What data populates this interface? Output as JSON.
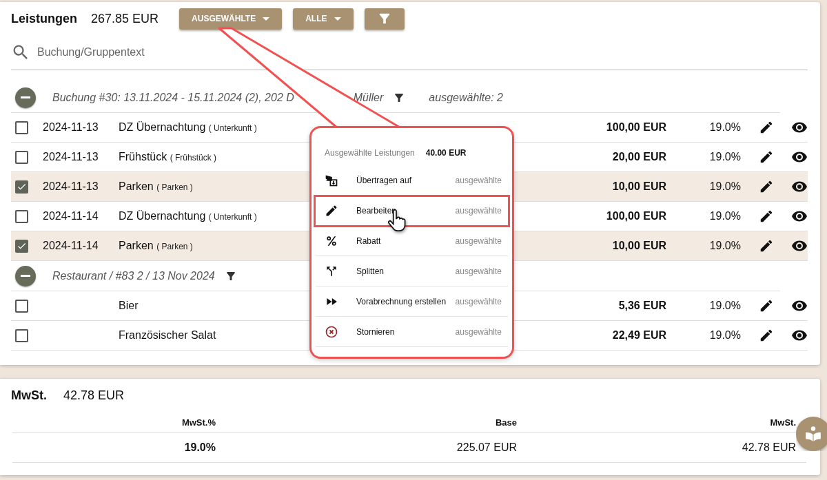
{
  "header": {
    "title": "Leistungen",
    "total": "267.85 EUR",
    "buttons": [
      {
        "kind": "dropdown",
        "label": "AUSGEWÄHLTE"
      },
      {
        "kind": "dropdown",
        "label": "ALLE"
      },
      {
        "kind": "filter"
      }
    ]
  },
  "search": {
    "placeholder": "Buchung/Gruppentext"
  },
  "groups": [
    {
      "expanded": true,
      "title_parts": [
        "Buchung #30: 13.11.2024 - 15.11.2024 (2), 202 D",
        "Müller"
      ],
      "selected_count": "ausgewählte: 2",
      "rows": [
        {
          "checked": false,
          "date": "2024-11-13",
          "name": "DZ Übernachtung",
          "category": "( Unterkunft )",
          "amount": "100,00 EUR",
          "vat": "19.0%"
        },
        {
          "checked": false,
          "date": "2024-11-13",
          "name": "Frühstück",
          "category": "( Frühstück )",
          "amount": "20,00 EUR",
          "vat": "19.0%"
        },
        {
          "checked": true,
          "date": "2024-11-13",
          "name": "Parken",
          "category": "( Parken )",
          "amount": "10,00 EUR",
          "vat": "19.0%"
        },
        {
          "checked": false,
          "date": "2024-11-14",
          "name": "DZ Übernachtung",
          "category": "( Unterkunft )",
          "amount": "100,00 EUR",
          "vat": "19.0%"
        },
        {
          "checked": true,
          "date": "2024-11-14",
          "name": "Parken",
          "category": "( Parken )",
          "amount": "10,00 EUR",
          "vat": "19.0%"
        }
      ]
    },
    {
      "expanded": true,
      "title_parts": [
        "Restaurant / #83 2 / 13 Nov 2024"
      ],
      "rows": [
        {
          "checked": false,
          "name": "Bier",
          "amount": "5,36 EUR",
          "vat": "19.0%"
        },
        {
          "checked": false,
          "name": "Französischer Salat",
          "amount": "22,49 EUR",
          "vat": "19.0%"
        }
      ]
    }
  ],
  "vat": {
    "title": "MwSt.",
    "total": "42.78 EUR",
    "columns": [
      "MwSt.%",
      "Base",
      "MwSt."
    ],
    "rows": [
      [
        "19.0%",
        "225.07 EUR",
        "42.78 EUR"
      ]
    ]
  },
  "menu": {
    "title": "Ausgewählte Leistungen",
    "total": "40.00 EUR",
    "items": [
      {
        "kind": "transfer",
        "label": "Übertragen auf",
        "scope": "ausgewählte",
        "highlighted": false
      },
      {
        "kind": "edit",
        "label": "Bearbeiten",
        "scope": "ausgewählte",
        "highlighted": true
      },
      {
        "kind": "discount",
        "label": "Rabatt",
        "scope": "ausgewählte",
        "highlighted": false
      },
      {
        "kind": "split",
        "label": "Splitten",
        "scope": "ausgewählte",
        "highlighted": false
      },
      {
        "kind": "prebill",
        "label": "Vorabrechnung erstellen",
        "scope": "ausgewählte",
        "highlighted": false
      },
      {
        "kind": "cancel",
        "label": "Stornieren",
        "scope": "ausgewählte",
        "highlighted": false
      }
    ]
  }
}
